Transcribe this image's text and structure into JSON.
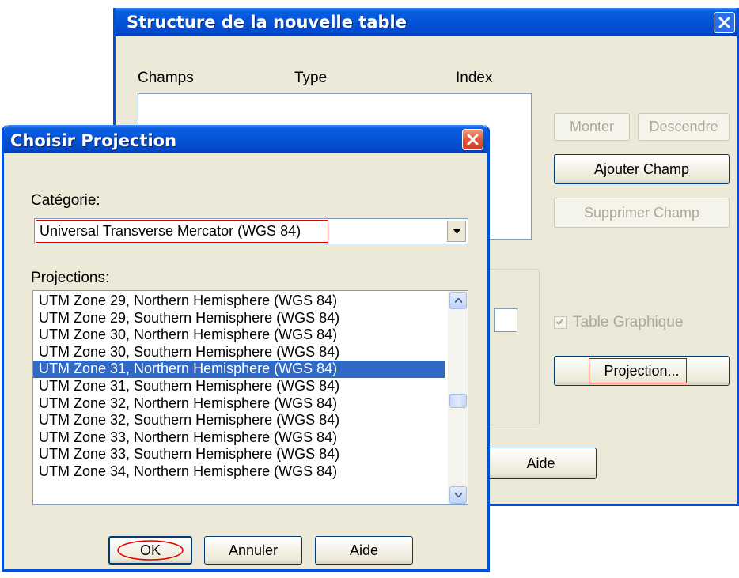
{
  "back_window": {
    "title": "Structure de la nouvelle table",
    "columns": {
      "fields": "Champs",
      "type": "Type",
      "index": "Index"
    },
    "buttons": {
      "up": "Monter",
      "down": "Descendre",
      "add_field": "Ajouter Champ",
      "delete_field": "Supprimer Champ",
      "projection": "Projection...",
      "help": "Aide"
    },
    "graphic_table": {
      "label": "Table Graphique",
      "checked": true
    }
  },
  "dialog": {
    "title": "Choisir Projection",
    "category_label": "Catégorie:",
    "category_value": "Universal Transverse Mercator (WGS 84)",
    "projections_label": "Projections:",
    "projections": [
      "UTM Zone 29, Northern Hemisphere (WGS 84)",
      "UTM Zone 29, Southern Hemisphere (WGS 84)",
      "UTM Zone 30, Northern Hemisphere (WGS 84)",
      "UTM Zone 30, Southern Hemisphere (WGS 84)",
      "UTM Zone 31, Northern Hemisphere (WGS 84)",
      "UTM Zone 31, Southern Hemisphere (WGS 84)",
      "UTM Zone 32, Northern Hemisphere (WGS 84)",
      "UTM Zone 32, Southern Hemisphere (WGS 84)",
      "UTM Zone 33, Northern Hemisphere (WGS 84)",
      "UTM Zone 33, Southern Hemisphere (WGS 84)",
      "UTM Zone 34, Northern Hemisphere (WGS 84)"
    ],
    "selected_projection": "UTM Zone 31, Northern Hemisphere (WGS 84)",
    "buttons": {
      "ok": "OK",
      "cancel": "Annuler",
      "help": "Aide"
    }
  },
  "colors": {
    "title_bar": "#0554d6",
    "selection": "#316ac5",
    "annotation": "#e00000",
    "close_button": "#e1583c"
  }
}
